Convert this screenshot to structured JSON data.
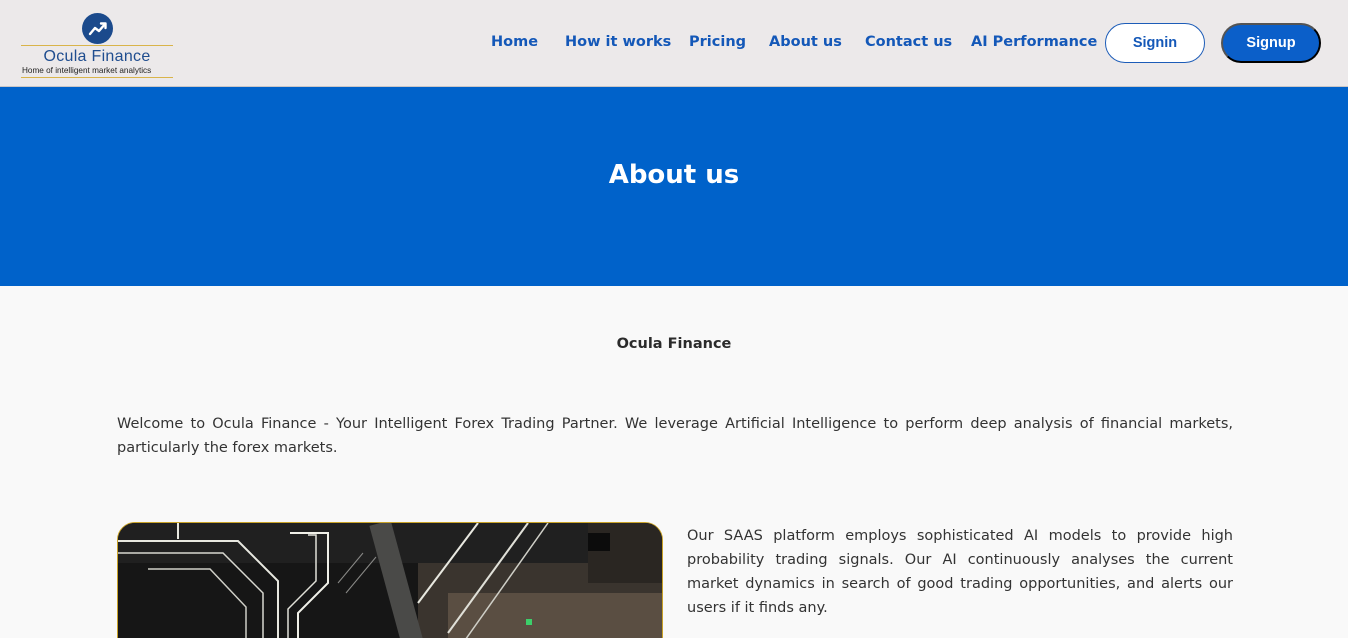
{
  "brand": {
    "name": "Ocula Finance",
    "tagline": "Home of intelligent market analytics",
    "logo_icon": "trending-up-icon"
  },
  "nav": {
    "links": [
      {
        "label": "Home"
      },
      {
        "label": "How it works"
      },
      {
        "label": "Pricing"
      },
      {
        "label": "About us"
      },
      {
        "label": "Contact us"
      },
      {
        "label": "AI Performance"
      }
    ],
    "signin_label": "Signin",
    "signup_label": "Signup"
  },
  "banner": {
    "title": "About us"
  },
  "content": {
    "heading": "Ocula Finance",
    "intro": "Welcome to Ocula Finance - Your Intelligent Forex Trading Partner. We leverage Artificial Intelligence to perform deep analysis of financial markets, particularly the forex markets.",
    "paragraph_2": "Our SAAS platform employs sophisticated AI models to provide high probability trading signals. Our AI continuously analyses the current market dynamics in search of good trading opportunities, and alerts our users if it finds any."
  },
  "colors": {
    "nav_bg": "#ece9ea",
    "brand_blue": "#0062ca",
    "link_blue": "#1458b8",
    "photo_border": "#c9a227"
  }
}
